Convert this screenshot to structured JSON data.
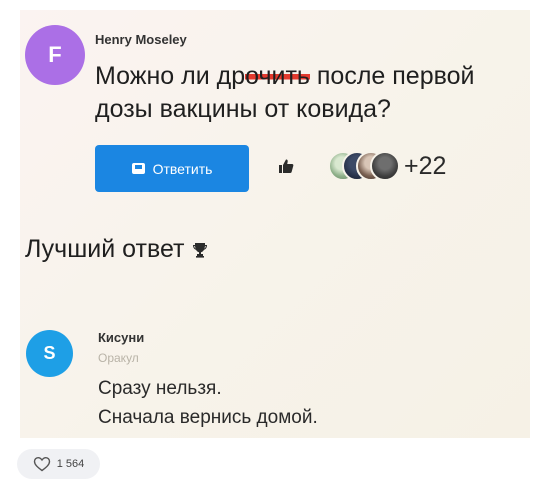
{
  "question": {
    "avatar_letter": "F",
    "author": "Henry Moseley",
    "text_before": "Можно ли др",
    "text_struck": "очить",
    "text_after": " после первой дозы вакцины от ковида?",
    "reply_label": "Ответить",
    "likers_more": "+22"
  },
  "best_answer": {
    "heading": "Лучший ответ",
    "avatar_letter": "S",
    "author": "Кисуни",
    "role": "Оракул",
    "line1": "Сразу нельзя.",
    "line2": "Сначала вернись домой."
  },
  "footer": {
    "likes": "1 564"
  },
  "icons": [
    "chat-icon",
    "thumbs-up-icon",
    "trophy-icon",
    "heart-icon"
  ],
  "colors": {
    "accent": "#1b86e2",
    "question_avatar": "#ab6fe6",
    "answer_avatar": "#1e9fe6",
    "strike": "#e33a2e"
  }
}
